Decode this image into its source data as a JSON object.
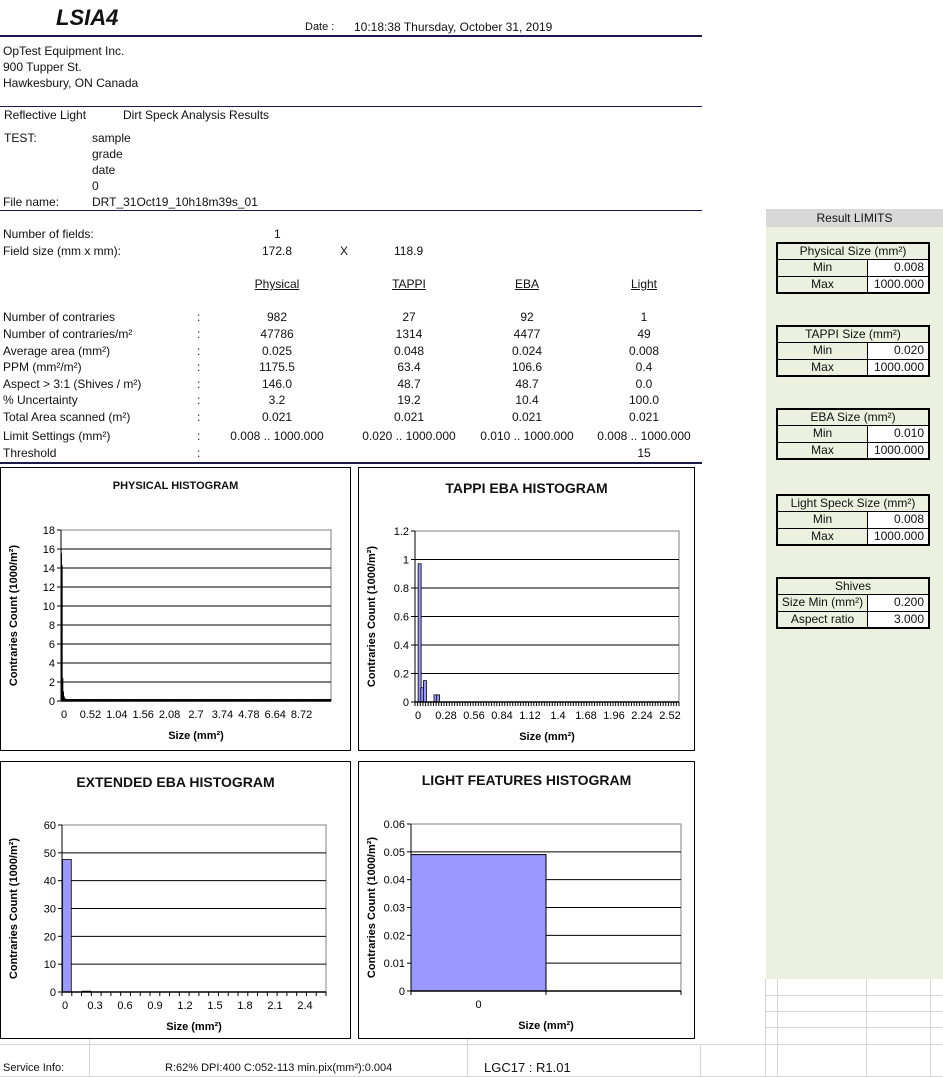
{
  "header": {
    "title": "LSIA4",
    "date_label": "Date :",
    "date_value": "10:18:38 Thursday, October 31, 2019"
  },
  "company": {
    "name": "OpTest Equipment Inc.",
    "street": "900 Tupper St.",
    "city": "Hawkesbury, ON Canada"
  },
  "mode": {
    "light": "Reflective Light",
    "analysis": "Dirt Speck Analysis Results"
  },
  "test": {
    "label": "TEST:",
    "values": [
      "sample",
      "grade",
      "date",
      "0"
    ],
    "file_label": "File name:",
    "file_value": "DRT_31Oct19_10h18m39s_01"
  },
  "fields": {
    "count_label": "Number of fields:",
    "count_value": "1",
    "size_label": "Field size (mm x mm):",
    "size_w": "172.8",
    "size_x": "X",
    "size_h": "118.9"
  },
  "results": {
    "columns": [
      "Physical",
      "TAPPI",
      "EBA",
      "Light"
    ],
    "sep": ":",
    "rows": [
      {
        "label": "Number of contraries",
        "values": [
          "982",
          "27",
          "92",
          "1"
        ]
      },
      {
        "label": "Number of contraries/m²",
        "values": [
          "47786",
          "1314",
          "4477",
          "49"
        ]
      },
      {
        "label": "Average area (mm²)",
        "values": [
          "0.025",
          "0.048",
          "0.024",
          "0.008"
        ]
      },
      {
        "label": "PPM (mm²/m²)",
        "values": [
          "1175.5",
          "63.4",
          "106.6",
          "0.4"
        ]
      },
      {
        "label": "Aspect > 3:1 (Shives / m²)",
        "values": [
          "146.0",
          "48.7",
          "48.7",
          "0.0"
        ]
      },
      {
        "label": "% Uncertainty",
        "values": [
          "3.2",
          "19.2",
          "10.4",
          "100.0"
        ]
      },
      {
        "label": "Total Area scanned (m²)",
        "values": [
          "0.021",
          "0.021",
          "0.021",
          "0.021"
        ]
      },
      {
        "label": "Limit Settings (mm²)",
        "values": [
          "0.008 .. 1000.000",
          "0.020 .. 1000.000",
          "0.010 .. 1000.000",
          "0.008 .. 1000.000"
        ]
      },
      {
        "label": "Threshold",
        "values": [
          "",
          "",
          "",
          "15"
        ]
      }
    ]
  },
  "limits": {
    "title": "Result LIMITS",
    "tables": [
      {
        "title": "Physical Size (mm²)",
        "rows": [
          {
            "k": "Min",
            "v": "0.008"
          },
          {
            "k": "Max",
            "v": "1000.000"
          }
        ]
      },
      {
        "title": "TAPPI Size (mm²)",
        "rows": [
          {
            "k": "Min",
            "v": "0.020"
          },
          {
            "k": "Max",
            "v": "1000.000"
          }
        ]
      },
      {
        "title": "EBA Size (mm²)",
        "rows": [
          {
            "k": "Min",
            "v": "0.010"
          },
          {
            "k": "Max",
            "v": "1000.000"
          }
        ]
      },
      {
        "title": "Light Speck Size (mm²)",
        "rows": [
          {
            "k": "Min",
            "v": "0.008"
          },
          {
            "k": "Max",
            "v": "1000.000"
          }
        ]
      },
      {
        "title": "Shives",
        "rows": [
          {
            "k": "Size Min (mm²)",
            "v": "0.200"
          },
          {
            "k": "Aspect ratio",
            "v": "3.000"
          }
        ]
      }
    ]
  },
  "footer": {
    "service_label": "Service Info:",
    "service_value": "R:62%  DPI:400  C:052-113  min.pix(mm²):0.004",
    "version": "LGC17 :  R1.01"
  },
  "chart_data": [
    {
      "type": "bar",
      "title": "PHYSICAL  HISTOGRAM",
      "xlabel": "Size (mm²)",
      "ylabel": "Contraries Count (1000/m²)",
      "ylim": [
        0,
        18
      ],
      "yticks": [
        0,
        2,
        4,
        6,
        8,
        10,
        12,
        14,
        16,
        18
      ],
      "xticklabels": [
        "0",
        "0.52",
        "1.04",
        "1.56",
        "2.08",
        "2.7",
        "3.74",
        "4.78",
        "6.64",
        "8.72"
      ],
      "bar_color": "#000000",
      "values": [
        15.6,
        14.3,
        2.4,
        1.0,
        0.5,
        0.3,
        0.25,
        0.2,
        0.15,
        0.15,
        0.12,
        0.1,
        0.1,
        0.1,
        0.08,
        0.08,
        0.05,
        0.05,
        0.05,
        0.05,
        0.05,
        0.05,
        0.05,
        0.05,
        0.1,
        0.05,
        0.05,
        0.05,
        0.05,
        0.05
      ],
      "grid": true
    },
    {
      "type": "bar",
      "title": "TAPPI EBA  HISTOGRAM",
      "xlabel": "Size (mm²)",
      "ylabel": "Contraries Count (1000/m²)",
      "ylim": [
        0,
        1.2
      ],
      "yticks": [
        0,
        0.2,
        0.4,
        0.6,
        0.8,
        1,
        1.2
      ],
      "yticklabels": [
        "0",
        "0.2",
        "0.4",
        "0.6",
        "0.8",
        "1",
        "1.2"
      ],
      "xticklabels": [
        "0",
        "0.28",
        "0.56",
        "0.84",
        "1.12",
        "1.4",
        "1.68",
        "1.96",
        "2.24",
        "2.52"
      ],
      "bin_count": 100,
      "bar_color": "#9999ff",
      "bars": [
        {
          "bin": 1,
          "value": 0.97
        },
        {
          "bin": 2,
          "value": 0.1
        },
        {
          "bin": 3,
          "value": 0.15
        },
        {
          "bin": 7,
          "value": 0.05
        },
        {
          "bin": 8,
          "value": 0.05
        }
      ],
      "grid": true
    },
    {
      "type": "bar",
      "title": "EXTENDED  EBA  HISTOGRAM",
      "xlabel": "Size (mm²)",
      "ylabel": "Contraries Count (1000/m²)",
      "ylim": [
        0,
        60
      ],
      "yticks": [
        0,
        10,
        20,
        30,
        40,
        50,
        60
      ],
      "xticklabels": [
        "0",
        "0.3",
        "0.6",
        "0.9",
        "1.2",
        "1.5",
        "1.8",
        "2.1",
        "2.4"
      ],
      "bin_count": 27,
      "bar_color": "#9999ff",
      "bars": [
        {
          "bin": 0,
          "value": 47.6
        },
        {
          "bin": 2,
          "value": 0.3
        }
      ],
      "grid": true
    },
    {
      "type": "bar",
      "title": "LIGHT FEATURES  HISTOGRAM",
      "xlabel": "Size (mm²)",
      "ylabel": "Contraries Count (1000/m²)",
      "ylim": [
        0,
        0.06
      ],
      "yticks": [
        0,
        0.01,
        0.02,
        0.03,
        0.04,
        0.05,
        0.06
      ],
      "yticklabels": [
        "0",
        "0.01",
        "0.02",
        "0.03",
        "0.04",
        "0.05",
        "0.06"
      ],
      "categories": [
        "0",
        ""
      ],
      "values": [
        0.049,
        0
      ],
      "bar_color": "#9999ff",
      "grid": true
    }
  ]
}
